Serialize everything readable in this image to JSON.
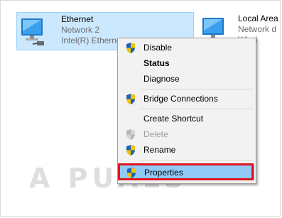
{
  "adapters": [
    {
      "name": "Ethernet",
      "network": "Network 2",
      "device": "Intel(R) Ethernet"
    },
    {
      "name": "Local Area",
      "network": "Network d",
      "device": "Wind"
    }
  ],
  "context_menu": {
    "items": [
      {
        "label": "Disable",
        "icon": "uac-shield-icon"
      },
      {
        "label": "Status",
        "bold": true
      },
      {
        "label": "Diagnose"
      },
      {
        "label": "Bridge Connections",
        "icon": "uac-shield-icon"
      },
      {
        "label": "Create Shortcut"
      },
      {
        "label": "Delete",
        "icon": "uac-shield-icon",
        "disabled": true
      },
      {
        "label": "Rename",
        "icon": "uac-shield-icon"
      },
      {
        "label": "Properties",
        "icon": "uac-shield-icon",
        "highlighted": true
      }
    ]
  },
  "watermark": "A PUALS",
  "colors": {
    "selection": "#cce8ff",
    "highlight": "#91c9f7",
    "annotation": "#e0141e"
  }
}
